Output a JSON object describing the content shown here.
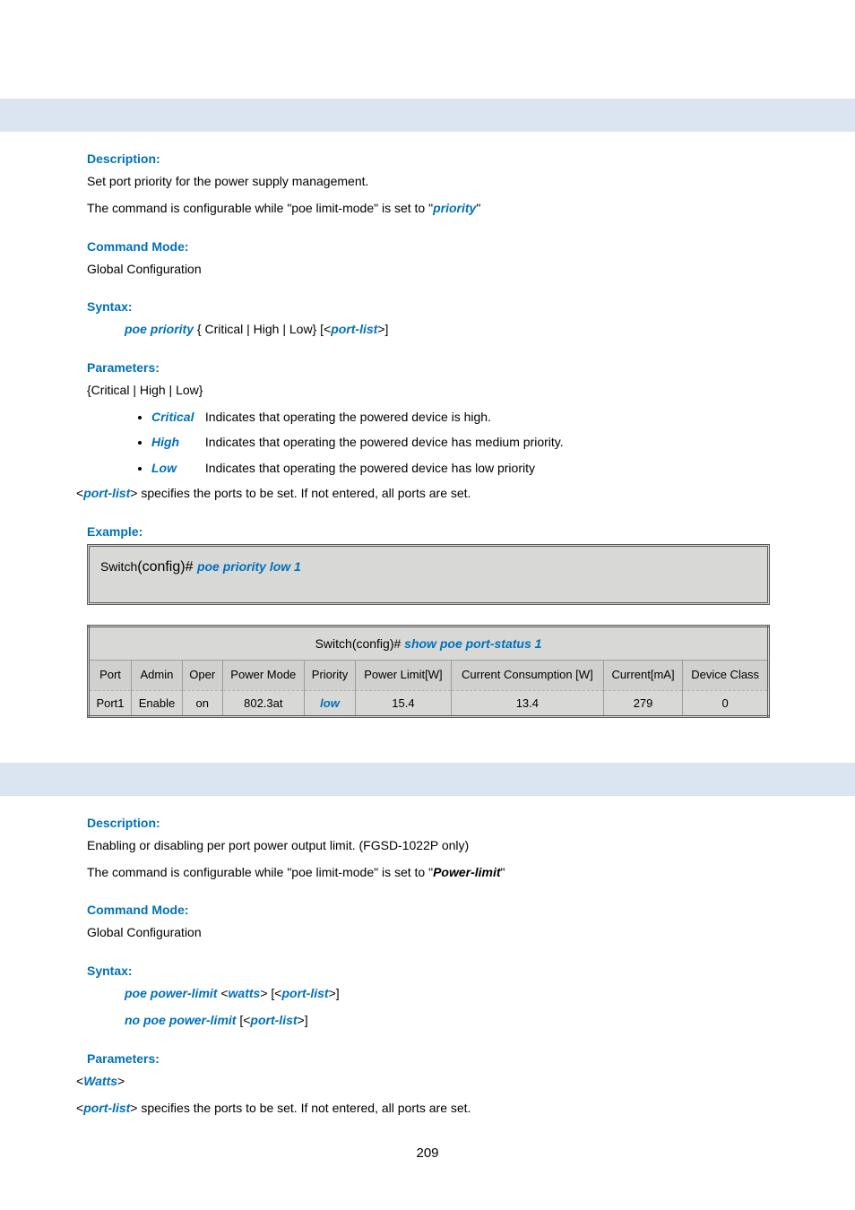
{
  "sec1": {
    "desc_heading": "Description:",
    "desc_line1": "Set port priority for the power supply management.",
    "desc_line2_a": "The command is configurable while \"poe limit-mode\" is set to \"",
    "desc_line2_b": "priority",
    "desc_line2_c": "\"",
    "mode_heading": "Command Mode:",
    "mode_value": "Global Configuration",
    "syntax_heading": "Syntax:",
    "syntax_cmd": "poe priority",
    "syntax_args": " { Critical | High | Low} [<",
    "syntax_ph": "port-list",
    "syntax_end": ">]",
    "param_heading": "Parameters:",
    "param_line": "{Critical | High | Low}",
    "opts": [
      {
        "name": "Critical",
        "desc": "Indicates that operating the powered device is high."
      },
      {
        "name": "High",
        "desc": "Indicates that operating the powered device has medium priority."
      },
      {
        "name": "Low",
        "desc": "Indicates that operating the powered device has low priority"
      }
    ],
    "portspec_a": "<",
    "portspec_b": "port-list",
    "portspec_c": "> specifies the ports to be set. If not entered, all ports are set.",
    "example_heading": "Example:",
    "ex1_prompt": "Switch",
    "ex1_prompt2": "(config)# ",
    "ex1_cmd": "poe priority low 1",
    "table_caption_a": "Switch(config)# ",
    "table_caption_b": "show poe port-status 1",
    "table": {
      "headers": [
        "Port",
        "Admin",
        "Oper",
        "Power Mode",
        "Priority",
        "Power Limit[W]",
        "Current Consumption [W]",
        "Current[mA]",
        "Device Class"
      ],
      "row": [
        "Port1",
        "Enable",
        "on",
        "802.3at",
        "low",
        "15.4",
        "13.4",
        "279",
        "0"
      ]
    }
  },
  "sec2": {
    "desc_heading": "Description:",
    "desc_line1": "Enabling or disabling per port power output limit. (FGSD-1022P only)",
    "desc_line2_a": "The command is configurable while \"poe limit-mode\" is set to \"",
    "desc_line2_b": "Power-limit",
    "desc_line2_c": "\"",
    "mode_heading": "Command Mode:",
    "mode_value": "Global Configuration",
    "syntax_heading": "Syntax:",
    "syntax1_cmd": "poe power-limit",
    "syntax1_a": " <",
    "syntax1_ph1": "watts",
    "syntax1_b": "> [<",
    "syntax1_ph2": "port-list",
    "syntax1_c": ">]",
    "syntax2_cmd": "no poe power-limit",
    "syntax2_a": " [<",
    "syntax2_ph": "port-list",
    "syntax2_b": ">]",
    "param_heading": "Parameters:",
    "p1_a": "<",
    "p1_b": "Watts",
    "p1_c": ">",
    "p2_a": "<",
    "p2_b": "port-list",
    "p2_c": "> specifies the ports to be set. If not entered, all ports are set."
  },
  "page_number": "209"
}
